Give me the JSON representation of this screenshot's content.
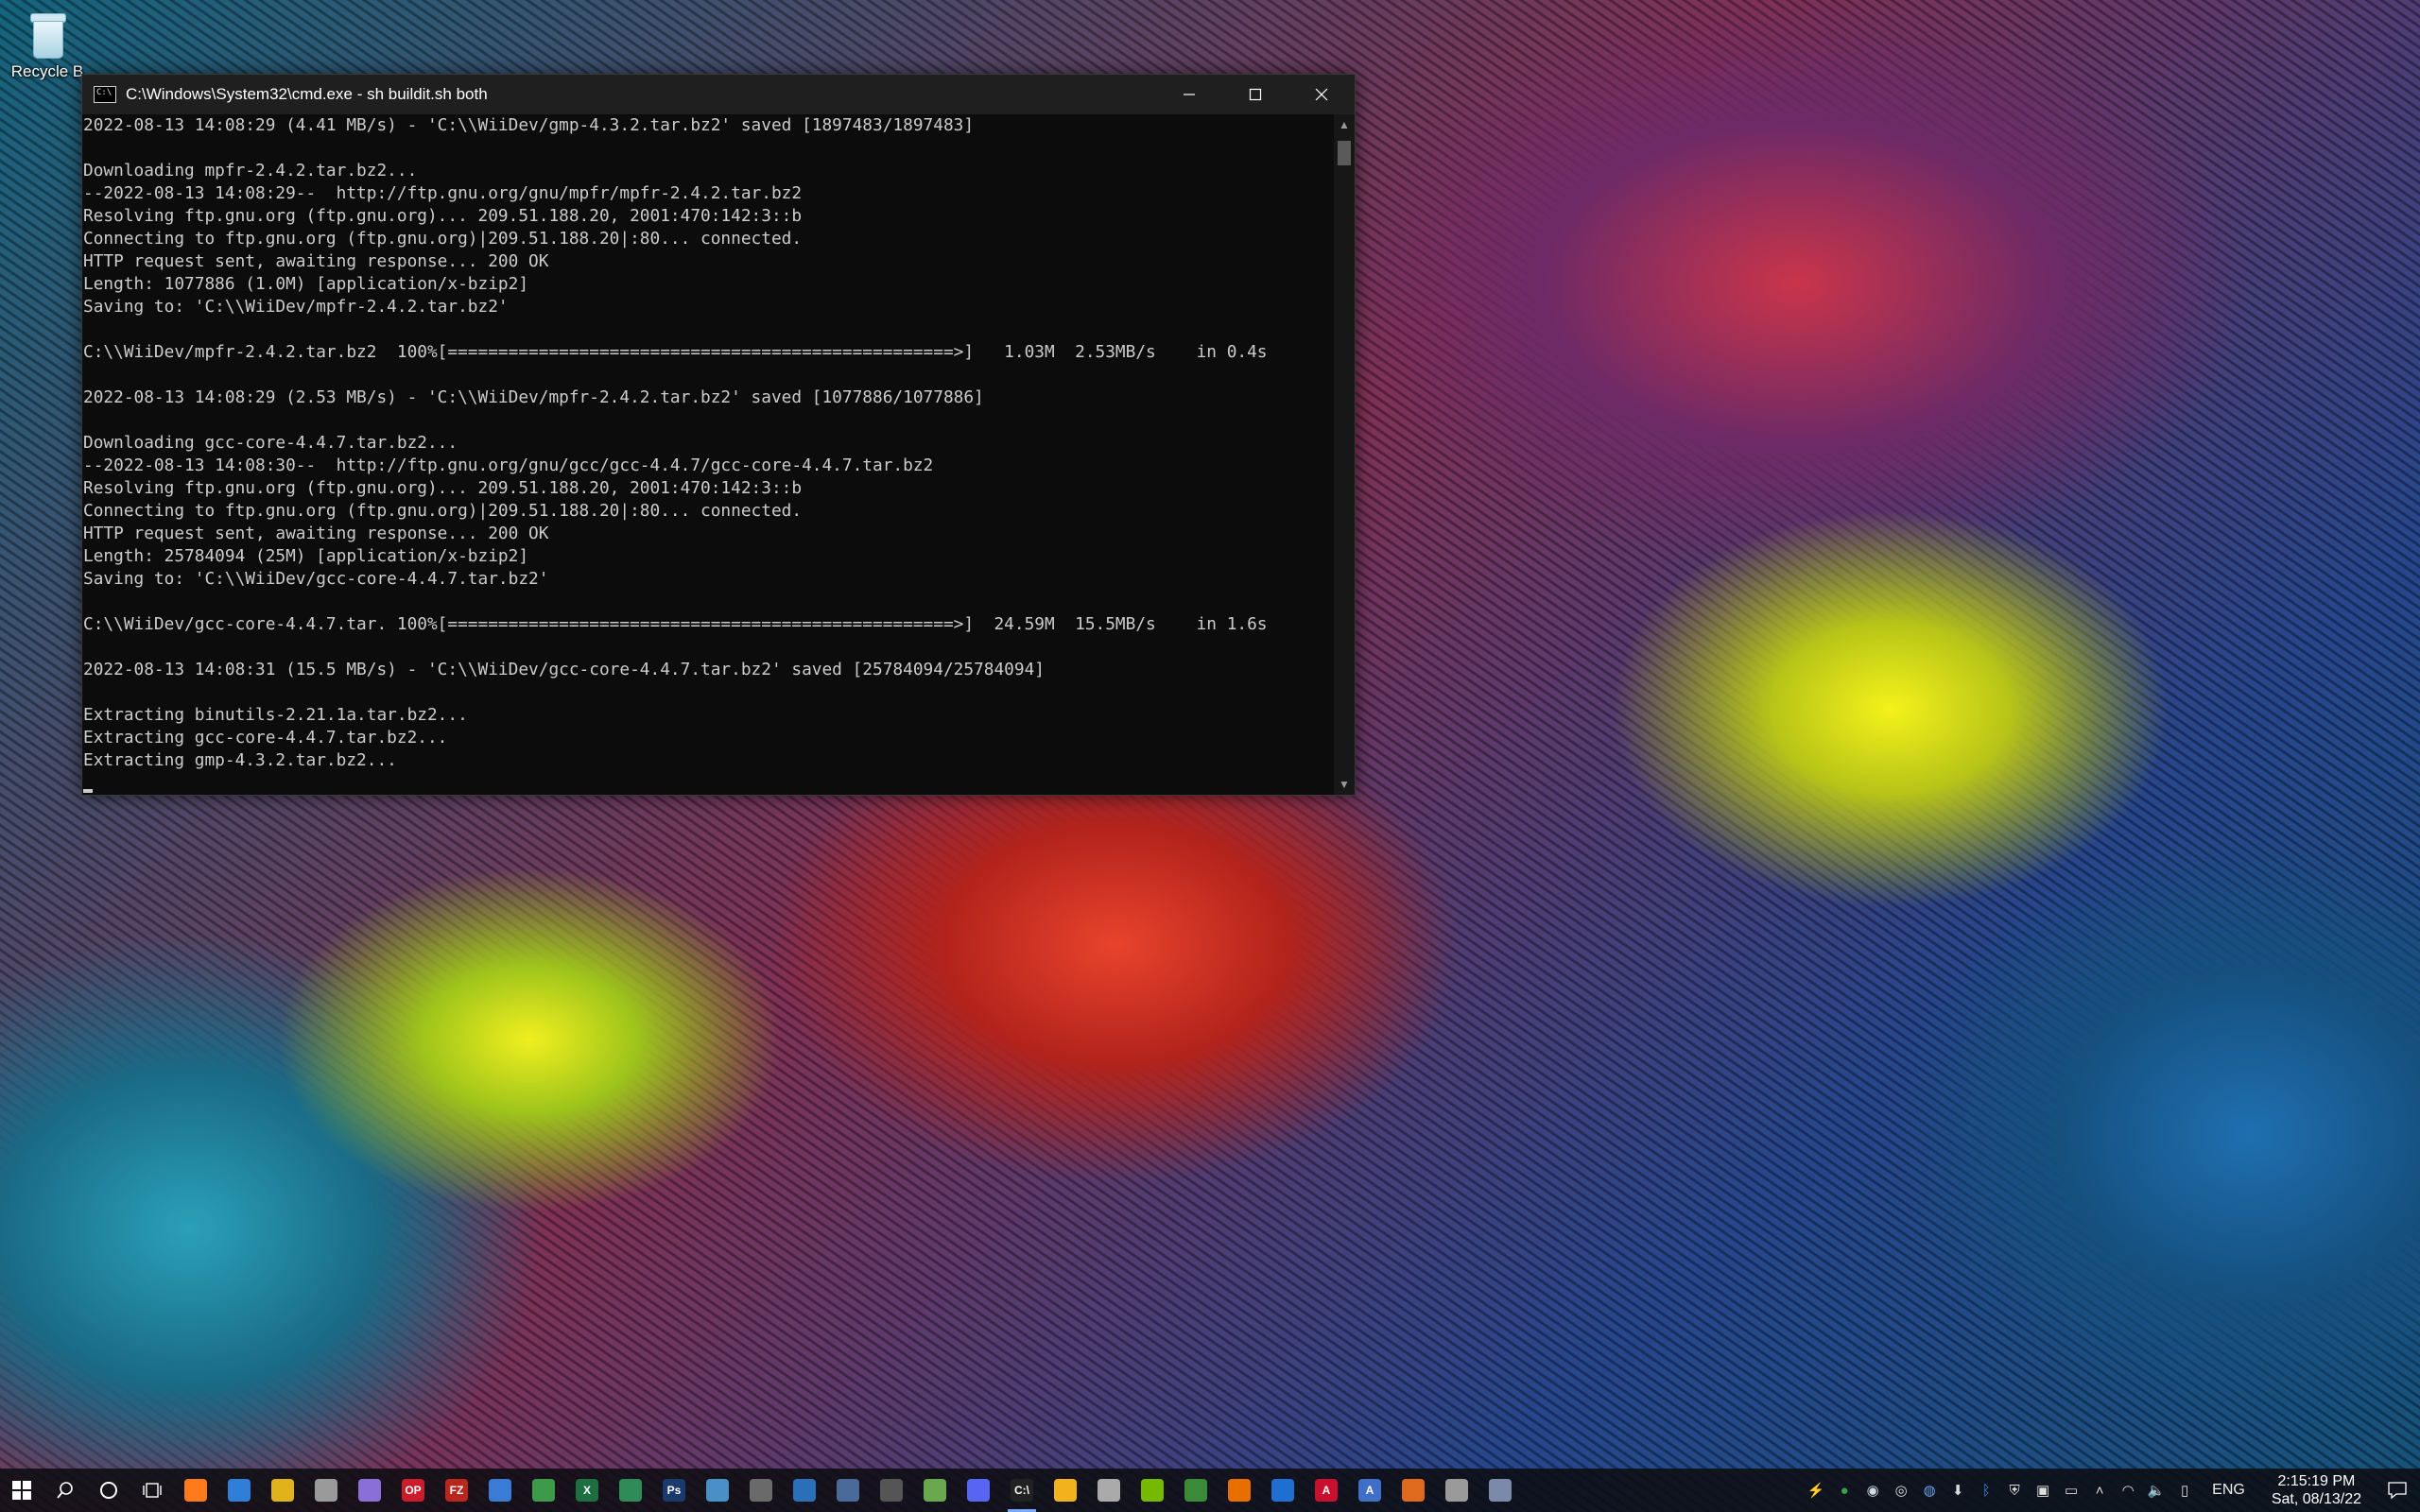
{
  "desktop": {
    "recycle_bin_label": "Recycle B"
  },
  "window": {
    "title": "C:\\Windows\\System32\\cmd.exe - sh  buildit.sh both",
    "buttons": {
      "minimize": "minimize",
      "maximize": "maximize",
      "close": "close"
    }
  },
  "terminal": {
    "lines": [
      "2022-08-13 14:08:29 (4.41 MB/s) - 'C:\\\\WiiDev/gmp-4.3.2.tar.bz2' saved [1897483/1897483]",
      "",
      "Downloading mpfr-2.4.2.tar.bz2...",
      "--2022-08-13 14:08:29--  http://ftp.gnu.org/gnu/mpfr/mpfr-2.4.2.tar.bz2",
      "Resolving ftp.gnu.org (ftp.gnu.org)... 209.51.188.20, 2001:470:142:3::b",
      "Connecting to ftp.gnu.org (ftp.gnu.org)|209.51.188.20|:80... connected.",
      "HTTP request sent, awaiting response... 200 OK",
      "Length: 1077886 (1.0M) [application/x-bzip2]",
      "Saving to: 'C:\\\\WiiDev/mpfr-2.4.2.tar.bz2'",
      "",
      "C:\\\\WiiDev/mpfr-2.4.2.tar.bz2  100%[==================================================>]   1.03M  2.53MB/s    in 0.4s",
      "",
      "2022-08-13 14:08:29 (2.53 MB/s) - 'C:\\\\WiiDev/mpfr-2.4.2.tar.bz2' saved [1077886/1077886]",
      "",
      "Downloading gcc-core-4.4.7.tar.bz2...",
      "--2022-08-13 14:08:30--  http://ftp.gnu.org/gnu/gcc/gcc-4.4.7/gcc-core-4.4.7.tar.bz2",
      "Resolving ftp.gnu.org (ftp.gnu.org)... 209.51.188.20, 2001:470:142:3::b",
      "Connecting to ftp.gnu.org (ftp.gnu.org)|209.51.188.20|:80... connected.",
      "HTTP request sent, awaiting response... 200 OK",
      "Length: 25784094 (25M) [application/x-bzip2]",
      "Saving to: 'C:\\\\WiiDev/gcc-core-4.4.7.tar.bz2'",
      "",
      "C:\\\\WiiDev/gcc-core-4.4.7.tar. 100%[==================================================>]  24.59M  15.5MB/s    in 1.6s",
      "",
      "2022-08-13 14:08:31 (15.5 MB/s) - 'C:\\\\WiiDev/gcc-core-4.4.7.tar.bz2' saved [25784094/25784094]",
      "",
      "Extracting binutils-2.21.1a.tar.bz2...",
      "Extracting gcc-core-4.4.7.tar.bz2...",
      "Extracting gmp-4.3.2.tar.bz2..."
    ]
  },
  "taskbar": {
    "icons": [
      {
        "name": "start-icon",
        "glyph": "",
        "color": "#ffffff"
      },
      {
        "name": "search-icon",
        "glyph": "",
        "color": "#ffffff"
      },
      {
        "name": "cortana-icon",
        "glyph": "",
        "color": "#ffffff"
      },
      {
        "name": "task-view-icon",
        "glyph": "",
        "color": "#ffffff"
      },
      {
        "name": "firefox-icon",
        "glyph": "",
        "color": "#ff7a1a"
      },
      {
        "name": "app-blue-icon",
        "glyph": "",
        "color": "#2f7fd8"
      },
      {
        "name": "app-yellow-icon",
        "glyph": "",
        "color": "#e0b21b"
      },
      {
        "name": "app-globe-icon",
        "glyph": "",
        "color": "#9a9a9a"
      },
      {
        "name": "app-rocket-icon",
        "glyph": "",
        "color": "#8a6fd8"
      },
      {
        "name": "opera-icon",
        "glyph": "OP",
        "color": "#cc1b2b"
      },
      {
        "name": "filezilla-icon",
        "glyph": "FZ",
        "color": "#b8261d"
      },
      {
        "name": "app-window-icon",
        "glyph": "",
        "color": "#3a7bd5"
      },
      {
        "name": "app-green-icon",
        "glyph": "",
        "color": "#3d9a4a"
      },
      {
        "name": "excel-icon",
        "glyph": "X",
        "color": "#1d6f42"
      },
      {
        "name": "app-sheet-icon",
        "glyph": "",
        "color": "#2e8b57"
      },
      {
        "name": "photoshop-icon",
        "glyph": "Ps",
        "color": "#1a3a6e"
      },
      {
        "name": "app-folder-icon",
        "glyph": "",
        "color": "#4a90c8"
      },
      {
        "name": "keyboard-icon",
        "glyph": "",
        "color": "#6a6a6a"
      },
      {
        "name": "app-book-icon",
        "glyph": "",
        "color": "#2a6fb8"
      },
      {
        "name": "app-calc-icon",
        "glyph": "",
        "color": "#4a6a9a"
      },
      {
        "name": "app-cursor-icon",
        "glyph": "",
        "color": "#555555"
      },
      {
        "name": "app-pen-icon",
        "glyph": "",
        "color": "#6aa84f"
      },
      {
        "name": "discord-icon",
        "glyph": "",
        "color": "#5865f2"
      },
      {
        "name": "cmd-icon",
        "glyph": "C:\\",
        "color": "#222222"
      },
      {
        "name": "weather-icon",
        "glyph": "",
        "color": "#f2b21d"
      },
      {
        "name": "app-gamepad-icon",
        "glyph": "",
        "color": "#aaaaaa"
      },
      {
        "name": "nvidia-icon",
        "glyph": "",
        "color": "#76b900"
      },
      {
        "name": "app-tree-icon",
        "glyph": "",
        "color": "#3a8a3a"
      },
      {
        "name": "java-icon",
        "glyph": "",
        "color": "#e76f00"
      },
      {
        "name": "app-shield-blue-icon",
        "glyph": "",
        "color": "#1f6fd1"
      },
      {
        "name": "acrobat-icon",
        "glyph": "A",
        "color": "#c8102e"
      },
      {
        "name": "app-a-icon",
        "glyph": "A",
        "color": "#3f6fc8"
      },
      {
        "name": "app-orange-icon",
        "glyph": "",
        "color": "#e06a1b"
      },
      {
        "name": "printer-icon",
        "glyph": "",
        "color": "#9a9a9a"
      },
      {
        "name": "app-monitor-icon",
        "glyph": "",
        "color": "#7a8aa8"
      }
    ],
    "tray": {
      "icons": [
        {
          "name": "lightning-icon",
          "glyph": "⚡",
          "color": "#2aa0ff"
        },
        {
          "name": "app-tray-green-icon",
          "glyph": "●",
          "color": "#3aa04a"
        },
        {
          "name": "steam-icon",
          "glyph": "◉",
          "color": "#cfd8e3"
        },
        {
          "name": "lifebuoy-icon",
          "glyph": "◎",
          "color": "#dddddd"
        },
        {
          "name": "globe-icon",
          "glyph": "◍",
          "color": "#6aa0e8"
        },
        {
          "name": "download-icon",
          "glyph": "⬇",
          "color": "#dddddd"
        },
        {
          "name": "bluetooth-icon",
          "glyph": "ᛒ",
          "color": "#3a8ae8"
        },
        {
          "name": "defender-icon",
          "glyph": "⛨",
          "color": "#dddddd"
        },
        {
          "name": "camera-icon",
          "glyph": "▣",
          "color": "#dddddd"
        },
        {
          "name": "battery-icon",
          "glyph": "▭",
          "color": "#dddddd"
        },
        {
          "name": "chevron-up-icon",
          "glyph": "˄",
          "color": "#dddddd"
        },
        {
          "name": "wifi-icon",
          "glyph": "◠",
          "color": "#dddddd"
        },
        {
          "name": "volume-icon",
          "glyph": "🔈",
          "color": "#dddddd"
        },
        {
          "name": "usb-icon",
          "glyph": "▯",
          "color": "#dddddd"
        }
      ],
      "language": "ENG",
      "time": "2:15:19 PM",
      "date": "Sat, 08/13/22"
    }
  }
}
